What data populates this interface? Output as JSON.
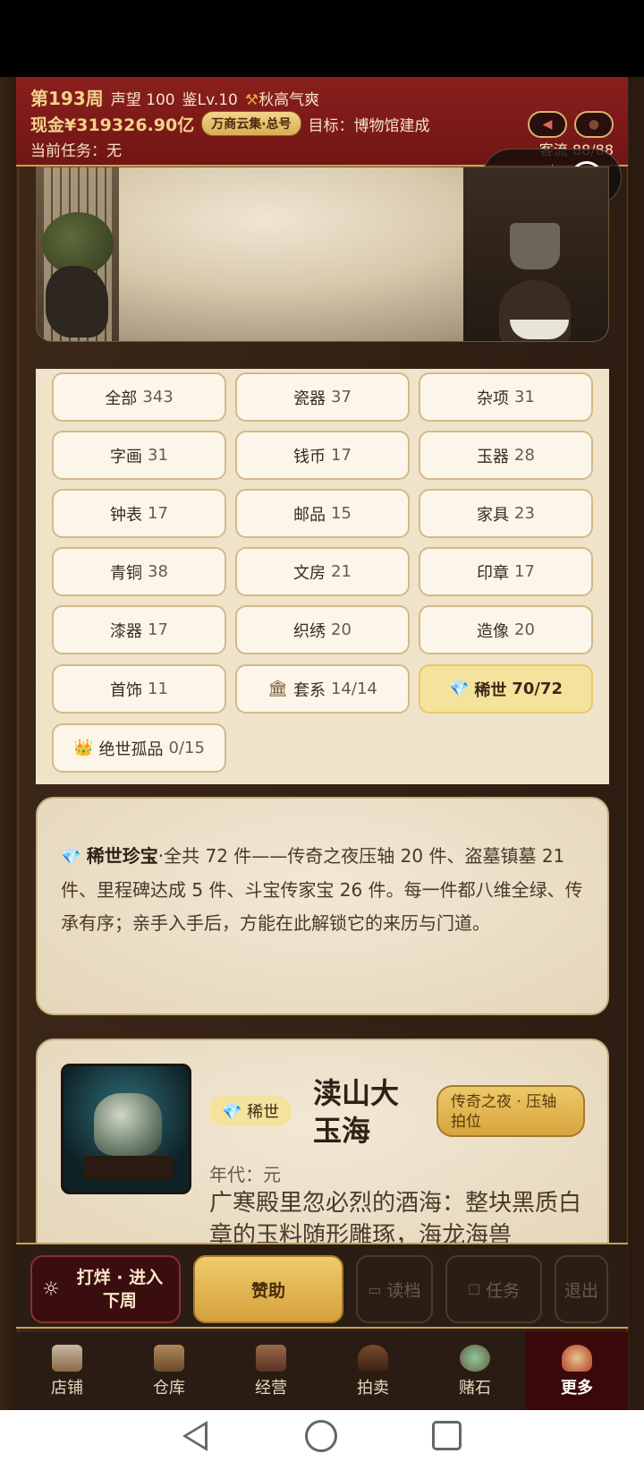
{
  "header": {
    "week": "第193周",
    "reputation": "声望 100",
    "appraisal_level": "鉴Lv.10",
    "weather": "秋高气爽",
    "cash": "现金¥319326.90亿",
    "pill": "万商云集·总号",
    "goal": "目标：博物馆建成",
    "task": "当前任务：无",
    "visitors": "客流 88/88"
  },
  "categories": [
    {
      "name": "全部",
      "count": "343"
    },
    {
      "name": "瓷器",
      "count": "37"
    },
    {
      "name": "杂项",
      "count": "31"
    },
    {
      "name": "字画",
      "count": "31"
    },
    {
      "name": "钱币",
      "count": "17"
    },
    {
      "name": "玉器",
      "count": "28"
    },
    {
      "name": "钟表",
      "count": "17"
    },
    {
      "name": "邮品",
      "count": "15"
    },
    {
      "name": "家具",
      "count": "23"
    },
    {
      "name": "青铜",
      "count": "38"
    },
    {
      "name": "文房",
      "count": "21"
    },
    {
      "name": "印章",
      "count": "17"
    },
    {
      "name": "漆器",
      "count": "17"
    },
    {
      "name": "织绣",
      "count": "20"
    },
    {
      "name": "造像",
      "count": "20"
    },
    {
      "name": "首饰",
      "count": "11"
    },
    {
      "name": "套系",
      "count": "14/14"
    },
    {
      "name": "稀世",
      "count": "70/72"
    },
    {
      "name": "绝世孤品",
      "count": "0/15"
    }
  ],
  "description": {
    "title": "稀世珍宝",
    "body": "·全共 72 件——传奇之夜压轴 20 件、盗墓镇墓 21 件、里程碑达成 5 件、斗宝传家宝 26 件。每一件都八维全绿、传承有序；亲手入手后，方能在此解锁它的来历与门道。"
  },
  "item": {
    "badge": "稀世",
    "name": "渎山大玉海",
    "tag": "传奇之夜 · 压轴拍位",
    "era": "年代：元",
    "story": "广寒殿里忽必烈的酒海：整块黑质白章的玉料随形雕琢，海龙海兽"
  },
  "actions": {
    "next_week": "打烊 · 进入下周",
    "sponsor": "赞助",
    "load": "读档",
    "tasks": "任务",
    "exit": "退出"
  },
  "nav": [
    {
      "label": "店铺",
      "icon": "shop-icon"
    },
    {
      "label": "仓库",
      "icon": "warehouse-icon"
    },
    {
      "label": "经营",
      "icon": "ledger-icon"
    },
    {
      "label": "拍卖",
      "icon": "gavel-icon"
    },
    {
      "label": "赌石",
      "icon": "jade-stone-icon"
    },
    {
      "label": "更多",
      "icon": "more-icon"
    }
  ],
  "colors": {
    "header_red": "#7a1a18",
    "gold": "#d9ad4f",
    "rare_highlight": "#f5e29c"
  }
}
